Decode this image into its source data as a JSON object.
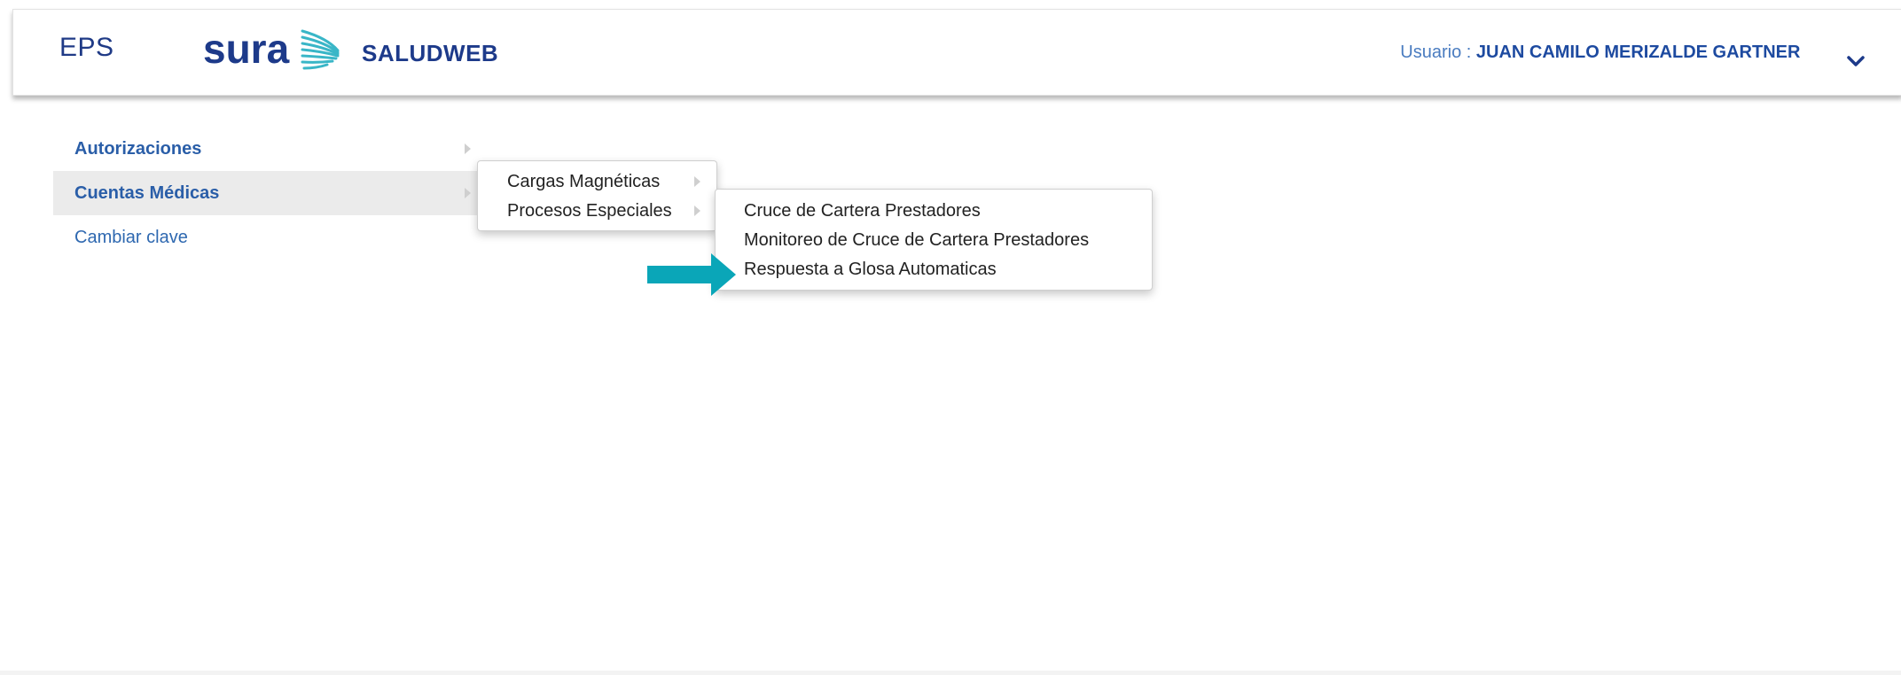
{
  "header": {
    "eps_label": "EPS",
    "brand": "sura",
    "app_name": "SALUDWEB",
    "user_prefix": "Usuario : ",
    "user_name": "JUAN CAMILO MERIZALDE GARTNER"
  },
  "sidebar": {
    "items": [
      {
        "label": "Autorizaciones"
      },
      {
        "label": "Cuentas Médicas"
      },
      {
        "label": "Cambiar clave"
      }
    ]
  },
  "submenu1": {
    "items": [
      {
        "label": "Cargas Magnéticas"
      },
      {
        "label": "Procesos Especiales"
      }
    ]
  },
  "submenu2": {
    "items": [
      {
        "label": "Cruce de Cartera Prestadores"
      },
      {
        "label": "Monitoreo de Cruce de Cartera Prestadores"
      },
      {
        "label": "Respuesta a Glosa Automaticas"
      }
    ]
  },
  "colors": {
    "brand_blue": "#1d3a8a",
    "link_blue": "#2e68b0",
    "accent_teal": "#0aa6b8",
    "active_bg": "#ebebeb"
  },
  "icons": [
    "sura-logo-icon",
    "chevron-down-icon",
    "chevron-right-icon",
    "callout-arrow-icon"
  ]
}
